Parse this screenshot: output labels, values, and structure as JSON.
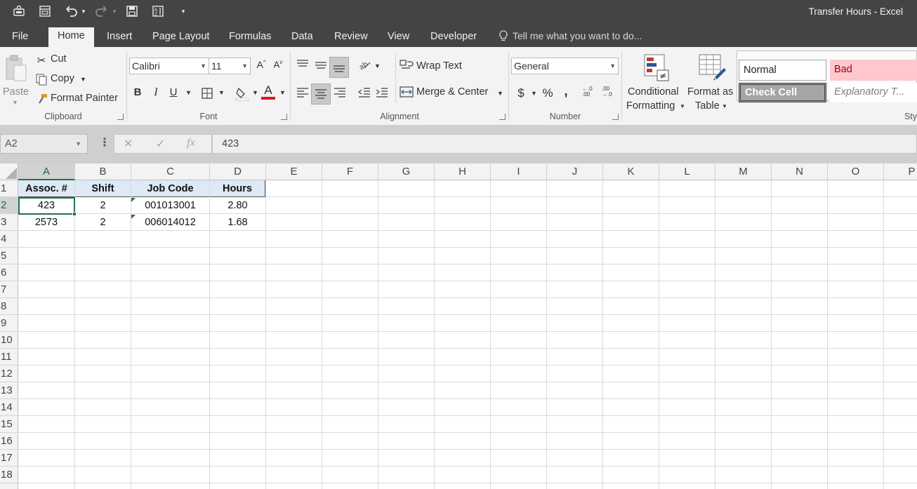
{
  "window": {
    "title": "Transfer Hours - Excel"
  },
  "quick_access": {
    "icons": [
      "connect-icon",
      "form-icon",
      "undo-icon",
      "redo-icon",
      "save-icon",
      "sort-icon",
      "customize-icon"
    ]
  },
  "tabs": [
    "File",
    "Home",
    "Insert",
    "Page Layout",
    "Formulas",
    "Data",
    "Review",
    "View",
    "Developer"
  ],
  "active_tab": "Home",
  "tell_me": "Tell me what you want to do...",
  "clipboard": {
    "label": "Clipboard",
    "paste": "Paste",
    "cut": "Cut",
    "copy": "Copy",
    "format_painter": "Format Painter"
  },
  "font": {
    "label": "Font",
    "name": "Calibri",
    "size": "11",
    "bold": "B",
    "italic": "I",
    "underline": "U",
    "font_color": "#e81123"
  },
  "alignment": {
    "label": "Alignment",
    "wrap_text": "Wrap Text",
    "merge_center": "Merge & Center"
  },
  "number": {
    "label": "Number",
    "format": "General",
    "currency": "$",
    "percent": "%",
    "comma": ","
  },
  "styles": {
    "label": "Sty",
    "conditional_formatting_line1": "Conditional",
    "conditional_formatting_line2": "Formatting",
    "format_as_table_line1": "Format as",
    "format_as_table_line2": "Table",
    "normal": "Normal",
    "bad": "Bad",
    "check_cell": "Check Cell",
    "explanatory": "Explanatory T..."
  },
  "formula_bar": {
    "name_box": "A2",
    "formula": "423"
  },
  "grid": {
    "columns": [
      "A",
      "B",
      "C",
      "D",
      "E",
      "F",
      "G",
      "H",
      "I",
      "J",
      "K",
      "L",
      "M",
      "N",
      "O",
      "P"
    ],
    "rows": [
      "1",
      "2",
      "3",
      "4",
      "5",
      "6",
      "7",
      "8",
      "9",
      "10",
      "11",
      "12",
      "13",
      "14",
      "15",
      "16",
      "17",
      "18"
    ],
    "selected_cell": "A2",
    "header_row": [
      "Assoc. #",
      "Shift",
      "Job Code",
      "Hours"
    ],
    "data_rows": [
      [
        "423",
        "2",
        "001013001",
        "2.80"
      ],
      [
        "2573",
        "2",
        "006014012",
        "1.68"
      ]
    ],
    "accent": "#217346",
    "header_fill": "#dde9f5"
  }
}
